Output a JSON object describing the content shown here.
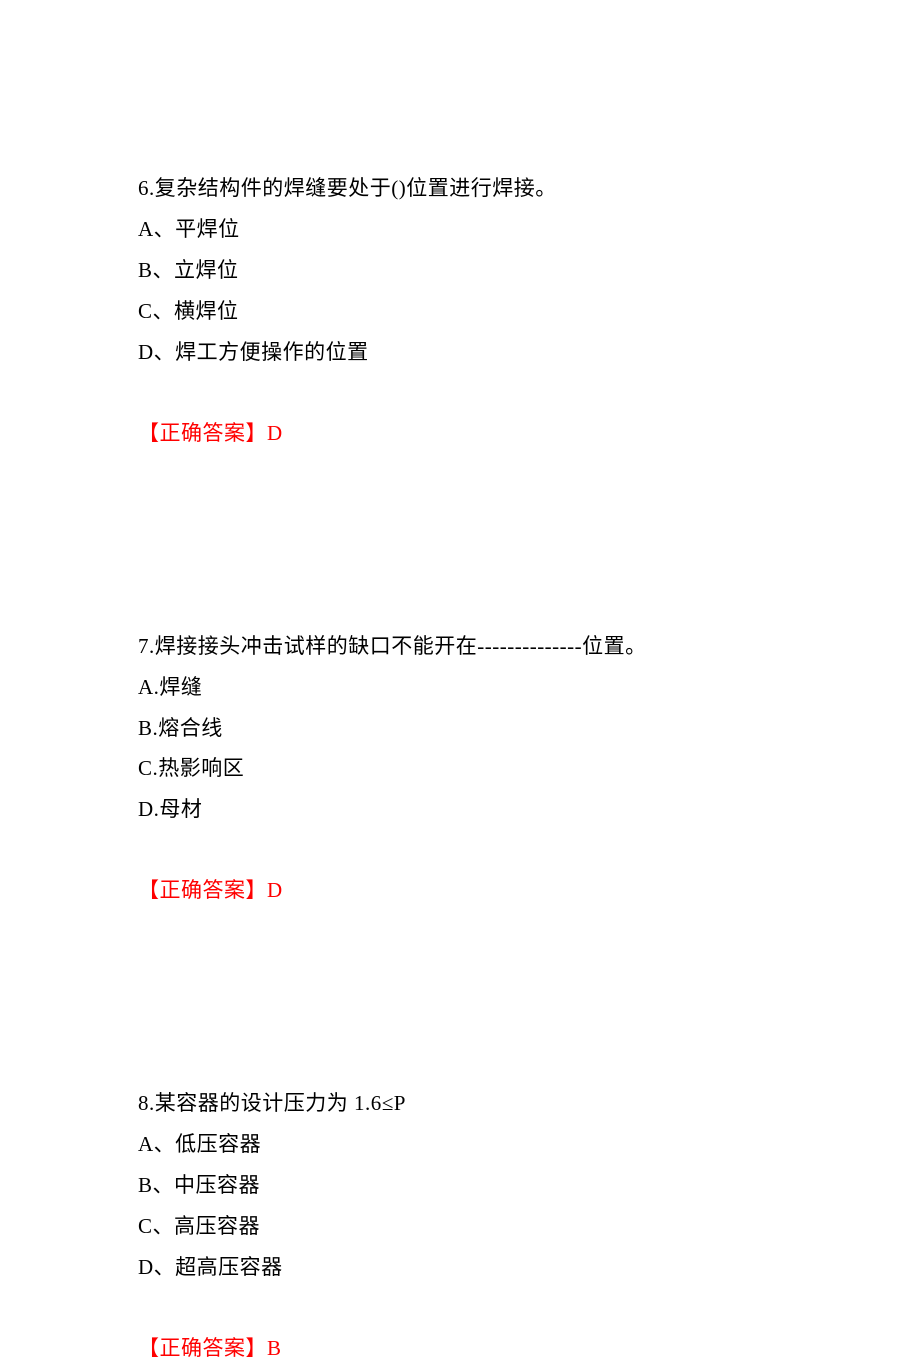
{
  "questions": [
    {
      "number": "6.",
      "text": "复杂结构件的焊缝要处于()位置进行焊接。",
      "options": [
        "A、平焊位",
        "B、立焊位",
        "C、横焊位",
        "D、焊工方便操作的位置"
      ],
      "answer_label": "【正确答案】",
      "answer_value": "D"
    },
    {
      "number": "7.",
      "text": "焊接接头冲击试样的缺口不能开在--------------位置。",
      "options": [
        "A.焊缝",
        "B.熔合线",
        "C.热影响区",
        "D.母材"
      ],
      "answer_label": "【正确答案】",
      "answer_value": "D"
    },
    {
      "number": "8.",
      "text": "某容器的设计压力为 1.6≤P",
      "options": [
        "A、低压容器",
        "B、中压容器",
        "C、高压容器",
        "D、超高压容器"
      ],
      "answer_label": "【正确答案】",
      "answer_value": "B"
    }
  ]
}
